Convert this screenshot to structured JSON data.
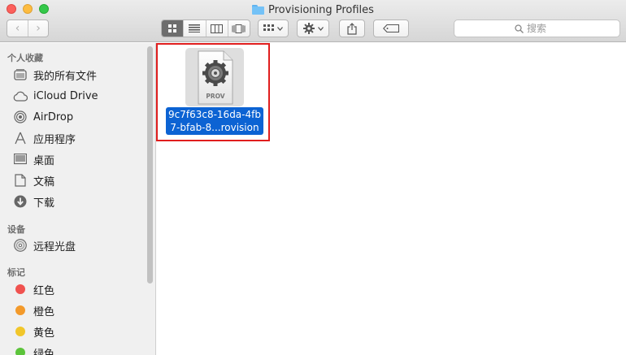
{
  "window": {
    "title": "Provisioning Profiles"
  },
  "toolbar": {
    "back_glyph": "‹",
    "forward_glyph": "›",
    "views": [
      "icon-view",
      "list-view",
      "column-view",
      "cover-flow-view"
    ],
    "active_view": "icon-view",
    "arrange_icon": "grid-arrange-icon",
    "action_icon": "gear-icon",
    "share_icon": "share-icon",
    "tag_icon": "tag-icon"
  },
  "search": {
    "placeholder": "搜索"
  },
  "sidebar": {
    "favorites_header": "个人收藏",
    "favorites": [
      {
        "label": "我的所有文件",
        "icon": "all-files-icon"
      },
      {
        "label": "iCloud Drive",
        "icon": "cloud-icon"
      },
      {
        "label": "AirDrop",
        "icon": "airdrop-icon"
      },
      {
        "label": "应用程序",
        "icon": "applications-icon"
      },
      {
        "label": "桌面",
        "icon": "desktop-icon"
      },
      {
        "label": "文稿",
        "icon": "documents-icon"
      },
      {
        "label": "下载",
        "icon": "downloads-icon"
      }
    ],
    "devices_header": "设备",
    "devices": [
      {
        "label": "远程光盘",
        "icon": "remote-disc-icon"
      }
    ],
    "tags_header": "标记",
    "tags": [
      {
        "label": "红色",
        "color": "#f0524f"
      },
      {
        "label": "橙色",
        "color": "#f39a2b"
      },
      {
        "label": "黄色",
        "color": "#f1c62a"
      },
      {
        "label": "绿色",
        "color": "#5cc43b"
      }
    ]
  },
  "files": [
    {
      "icon_label": "PROV",
      "name_line1": "9c7f63c8-16da-4fb",
      "name_line2": "7-bfab-8...rovision",
      "selected": true
    }
  ],
  "colors": {
    "selection": "#0c63d3",
    "highlight_border": "#e01e1e"
  }
}
